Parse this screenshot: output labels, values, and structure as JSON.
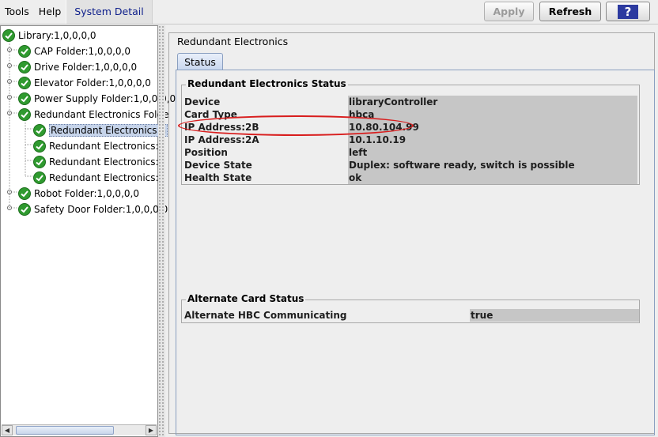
{
  "menu": {
    "tools": "Tools",
    "help": "Help",
    "system_detail": "System Detail"
  },
  "toolbar": {
    "apply": "Apply",
    "refresh": "Refresh",
    "help_glyph": "?"
  },
  "tree": {
    "items": [
      {
        "label": "Library:1,0,0,0,0"
      },
      {
        "label": "CAP Folder:1,0,0,0,0"
      },
      {
        "label": "Drive Folder:1,0,0,0,0"
      },
      {
        "label": "Elevator Folder:1,0,0,0,0"
      },
      {
        "label": "Power Supply Folder:1,0,0,0,0"
      },
      {
        "label": "Redundant Electronics Folde"
      },
      {
        "label": "Redundant Electronics:h"
      },
      {
        "label": "Redundant Electronics:h"
      },
      {
        "label": "Redundant Electronics:h"
      },
      {
        "label": "Redundant Electronics:h"
      },
      {
        "label": "Robot Folder:1,0,0,0,0"
      },
      {
        "label": "Safety Door Folder:1,0,0,0,0"
      }
    ]
  },
  "detail": {
    "title": "Redundant Electronics",
    "tab": "Status",
    "status_group": {
      "title": "Redundant Electronics Status",
      "rows": [
        {
          "label": "Device",
          "value": "libraryController"
        },
        {
          "label": "Card Type",
          "value": "hbca"
        },
        {
          "label": "IP Address:2B",
          "value": "10.80.104.99"
        },
        {
          "label": "IP Address:2A",
          "value": "10.1.10.19"
        },
        {
          "label": "Position",
          "value": "left"
        },
        {
          "label": "Device State",
          "value": "Duplex: software ready, switch is possible"
        },
        {
          "label": "Health State",
          "value": "ok"
        }
      ]
    },
    "alt_group": {
      "title": "Alternate Card Status",
      "rows": [
        {
          "label": "Alternate HBC Communicating",
          "value": "true"
        }
      ]
    }
  },
  "colors": {
    "ok_green": "#2f9a2f",
    "highlight_red": "#d81d1d",
    "selection": "#c6d4ea"
  }
}
